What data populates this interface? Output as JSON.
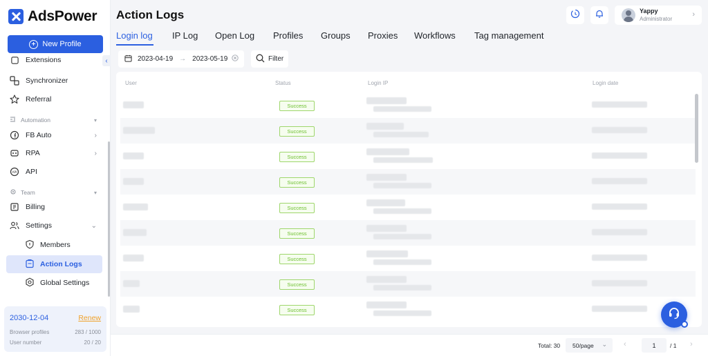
{
  "app": {
    "brand": "AdsPower",
    "new_profile_label": "New Profile",
    "collapse_glyph": "‹"
  },
  "sidebar": {
    "items": [
      {
        "label": "Extensions",
        "icon": "extensions-icon",
        "partial": true
      },
      {
        "label": "Synchronizer",
        "icon": "synchronizer-icon"
      },
      {
        "label": "Referral",
        "icon": "star-icon"
      }
    ],
    "automation_group": "Automation",
    "automation_items": [
      {
        "label": "FB Auto",
        "icon": "fb-auto-icon"
      },
      {
        "label": "RPA",
        "icon": "rpa-icon"
      },
      {
        "label": "API",
        "icon": "api-icon"
      }
    ],
    "team_group": "Team",
    "team_items": [
      {
        "label": "Billing",
        "icon": "billing-icon"
      },
      {
        "label": "Settings",
        "icon": "settings-users-icon"
      }
    ],
    "settings_sub": [
      {
        "label": "Members",
        "icon": "shield-icon"
      },
      {
        "label": "Action Logs",
        "icon": "clipboard-icon",
        "active": true
      },
      {
        "label": "Global Settings",
        "icon": "global-settings-icon"
      }
    ]
  },
  "account": {
    "expiry": "2030-12-04",
    "renew_label": "Renew",
    "browser_profiles_label": "Browser profiles",
    "browser_profiles_value": "283 / 1000",
    "user_number_label": "User number",
    "user_number_value": "20 / 20"
  },
  "header": {
    "title": "Action Logs",
    "user_name": "Yappy",
    "user_role": "Administrator"
  },
  "tabs": [
    "Login log",
    "IP Log",
    "Open Log",
    "Profiles",
    "Groups",
    "Proxies",
    "Workflows",
    "Tag management"
  ],
  "active_tab": "Login log",
  "filters": {
    "start_date": "2023-04-19",
    "end_date": "2023-05-19",
    "arrow": "→",
    "filter_label": "Filter"
  },
  "table": {
    "columns": [
      "User",
      "Status",
      "Login IP",
      "Login date"
    ],
    "status_label": "Success",
    "row_count_visible": 9,
    "rows_status": [
      "Success",
      "Success",
      "Success",
      "Success",
      "Success",
      "Success",
      "Success",
      "Success",
      "Success"
    ]
  },
  "pagination": {
    "total_label": "Total: 30",
    "per_page": "50/page",
    "current_page": "1",
    "of_pages": "/ 1",
    "prev_glyph": "‹",
    "next_glyph": "›"
  },
  "colors": {
    "accent": "#2b5fe0",
    "success": "#6cbf2e",
    "renew": "#f0a22b"
  }
}
